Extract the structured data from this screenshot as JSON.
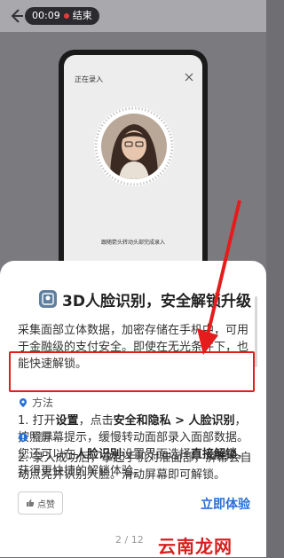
{
  "topbar": {
    "time": "00:09",
    "recording_status": "结束"
  },
  "phone": {
    "screen_title": "正在录入",
    "hint": "跟随箭头转动头部完成录入"
  },
  "card": {
    "title": "3D人脸识别，安全解锁升级",
    "description": "采集面部立体数据，加密存储在手机中，可用于金融级的支付安全。即使在无光条件下，也能快速解锁。",
    "method_label": "方法",
    "step1": {
      "prefix": "1. 打开",
      "settings": "设置",
      "mid": "，点击",
      "path": "安全和隐私 > 人脸识别",
      "suffix": "，按照屏幕提示，缓慢转动面部录入面部数据。"
    },
    "step2": "2. 录入成功后，拿起手机对准面部，屏幕会自动点亮并识别人脸。滑动屏幕即可解锁。",
    "tip_label": "提示",
    "tip": {
      "prefix": "您还可以在",
      "face_recognition": "人脸识别",
      "mid": "设置界面选择",
      "direct_unlock": "直接解锁",
      "suffix": "，获得更快捷的解锁体验。"
    },
    "like_label": "点赞",
    "try_button": "立即体验",
    "pager": "2 / 12"
  },
  "watermark": "云南龙网",
  "colors": {
    "accent": "#2a6fd6",
    "highlight": "#e51c1c"
  }
}
